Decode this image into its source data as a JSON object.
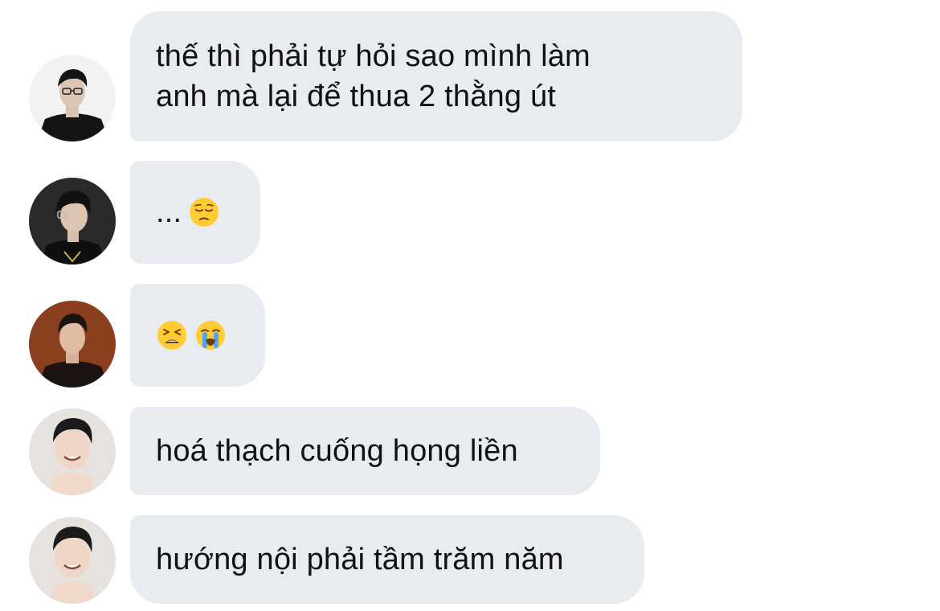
{
  "conversation": {
    "messages": [
      {
        "sender_avatar": "avatar-glasses-black-outfit",
        "text": "thế thì phải tự hỏi sao mình làm\nanh mà lại để thua 2 thằng út",
        "emojis": []
      },
      {
        "sender_avatar": "avatar-glasses-side-profile",
        "text": "...",
        "emojis": [
          "pensive-face-emoji"
        ]
      },
      {
        "sender_avatar": "avatar-brown-background",
        "text": "",
        "emojis": [
          "tired-face-emoji",
          "loudly-crying-face-emoji"
        ]
      },
      {
        "sender_avatar": "avatar-smiling-hand-chin",
        "text": "hoá thạch cuống họng liền",
        "emojis": []
      },
      {
        "sender_avatar": "avatar-smiling-hand-chin",
        "text": "hướng nội phải tầm trăm năm",
        "emojis": []
      }
    ]
  },
  "colors": {
    "bubble_background": "#e8ecf0",
    "text": "#111111",
    "page_background": "#ffffff"
  }
}
